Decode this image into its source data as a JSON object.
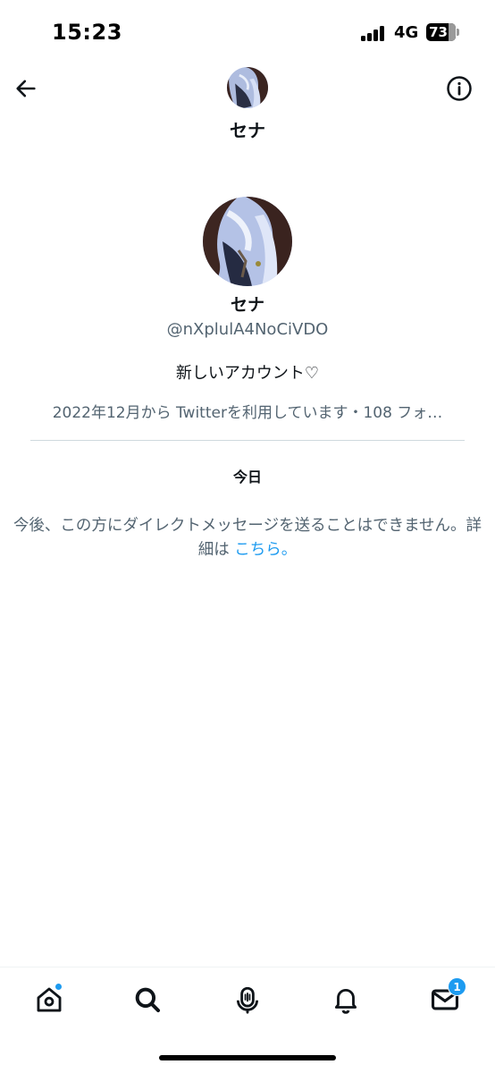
{
  "status_bar": {
    "time": "15:23",
    "network": "4G",
    "battery": "73",
    "signal_bars": 4,
    "battery_level_percent": 73
  },
  "header": {
    "title": "セナ",
    "back_icon": "arrow-left-icon",
    "info_icon": "info-icon"
  },
  "profile": {
    "name": "セナ",
    "handle": "@nXplulA4NoCiVDO",
    "bio": "新しいアカウント♡",
    "meta": "2022年12月から Twitterを利用しています・108 フォ…"
  },
  "conversation": {
    "date_label": "今日",
    "notice_text": "今後、この方にダイレクトメッセージを送ることはできません。詳細は ",
    "notice_link": "こちら。"
  },
  "bottom_nav": {
    "items": [
      {
        "name": "home",
        "icon": "home-icon",
        "has_dot": true
      },
      {
        "name": "search",
        "icon": "search-icon"
      },
      {
        "name": "spaces",
        "icon": "microphone-icon"
      },
      {
        "name": "notifications",
        "icon": "bell-icon"
      },
      {
        "name": "messages",
        "icon": "envelope-icon",
        "badge": "1"
      }
    ]
  },
  "colors": {
    "accent": "#1d9bf0",
    "text_primary": "#0f1419",
    "text_secondary": "#536471",
    "divider": "#cfd9de"
  }
}
